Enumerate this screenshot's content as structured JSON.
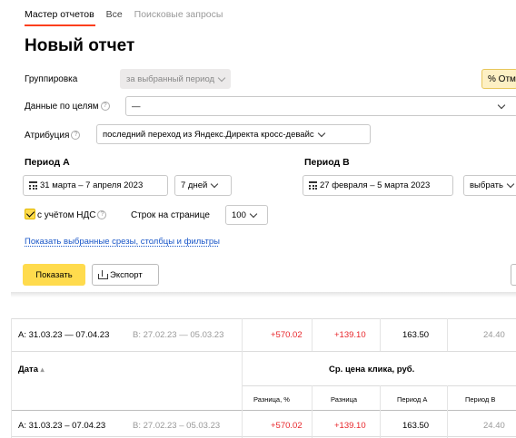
{
  "tabs": [
    {
      "label": "Мастер отчетов"
    },
    {
      "label": "Все"
    },
    {
      "label": "Поисковые запросы"
    }
  ],
  "page_title": "Новый отчет",
  "grouping": {
    "label": "Группировка",
    "value": "за выбранный период"
  },
  "percent_button": "% Отм",
  "goals": {
    "label": "Данные по целям",
    "value": "—"
  },
  "attribution": {
    "label": "Атрибуция",
    "value": "последний переход из Яндекс.Директа кросс-девайс"
  },
  "period_a": {
    "label": "Период A",
    "dates": "31 марта – 7 апреля 2023",
    "preset": "7 дней"
  },
  "period_b": {
    "label": "Период B",
    "dates": "27 февраля – 5 марта 2023",
    "preset": "выбрать"
  },
  "vat": {
    "label": "с учётом НДС",
    "checked": true
  },
  "rows_per_page": {
    "label": "Строк на странице",
    "value": "100"
  },
  "show_filters_link": "Показать выбранные срезы, столбцы и фильтры",
  "actions": {
    "show": "Показать",
    "export": "Экспорт"
  },
  "table": {
    "summary_row": {
      "a": "A: 31.03.23 — 07.04.23",
      "b": "B: 27.02.23 — 05.03.23",
      "diff_pct": "+570.02",
      "diff": "+139.10",
      "period_a": "163.50",
      "period_b": "24.40"
    },
    "date_header": "Дата",
    "sort_indicator": "▴",
    "metric_header": "Ср. цена клика, руб.",
    "sub_headers": [
      "Разница, %",
      "Разница",
      "Период A",
      "Период B"
    ],
    "data_row": {
      "a": "A: 31.03.23 – 07.04.23",
      "b": "B: 27.02.23 – 05.03.23",
      "diff_pct": "+570.02",
      "diff": "+139.10",
      "period_a": "163.50",
      "period_b": "24.40"
    }
  },
  "colors": {
    "accent": "#ffdb4d",
    "tab_underline": "#fc3f1d",
    "link": "#1a57c8",
    "negative_red": "#e8262b"
  }
}
